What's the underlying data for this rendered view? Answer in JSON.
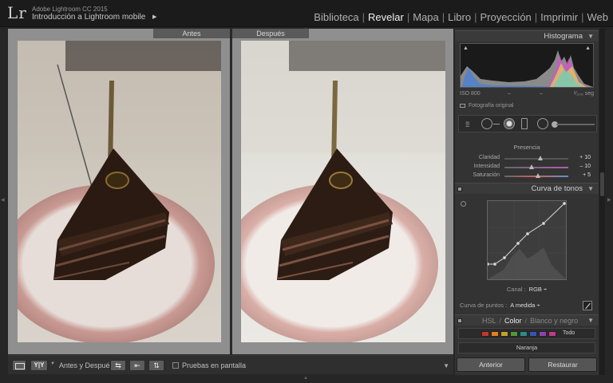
{
  "app": {
    "logo": "Lr",
    "name": "Adobe Lightroom CC 2015",
    "catalog": "Introducción a Lightroom mobile",
    "catalog_arrow": "▶"
  },
  "modules": [
    {
      "label": "Biblioteca",
      "active": false
    },
    {
      "label": "Revelar",
      "active": true
    },
    {
      "label": "Mapa",
      "active": false
    },
    {
      "label": "Libro",
      "active": false
    },
    {
      "label": "Proyección",
      "active": false
    },
    {
      "label": "Imprimir",
      "active": false
    },
    {
      "label": "Web",
      "active": false
    }
  ],
  "view": {
    "before_label": "Antes",
    "after_label": "Después"
  },
  "toolbar": {
    "yy_label": "Y|Y",
    "compare_label": "Antes y Después:",
    "swap1_glyph": "⇆",
    "swap2_glyph": "⇤",
    "swap3_glyph": "⇅",
    "proof_label": "Pruebas en pantalla",
    "menu_arrow": "▼"
  },
  "histogram": {
    "title": "Histograma",
    "iso": "ISO 800",
    "dash1": "–",
    "dash2": "–",
    "shutter": "¹⁄₂₀₀ seg",
    "original_label": "Fotografía original",
    "clip_glyph": "▲"
  },
  "presence": {
    "title": "Presencia",
    "rows": [
      {
        "label": "Claridad",
        "value": "+ 10"
      },
      {
        "label": "Intensidad",
        "value": "– 10"
      },
      {
        "label": "Saturación",
        "value": "+ 5"
      }
    ]
  },
  "tone_curve": {
    "title": "Curva de tonos",
    "channel_label": "Canal :",
    "channel_value": "RGB ÷",
    "points_label": "Curva de puntos :",
    "points_value": "A medida ÷"
  },
  "hsl": {
    "hsl_label": "HSL",
    "color_label": "Color",
    "bw_label": "Blanco y negro",
    "all_label": "Todo",
    "selected_color": "Naranja",
    "swatches": [
      "#c0392b",
      "#e67e22",
      "#c9a227",
      "#4f9a3a",
      "#2e8b8b",
      "#3456b4",
      "#8e44ad",
      "#c23a8a"
    ]
  },
  "buttons": {
    "previous": "Anterior",
    "reset": "Restaurar"
  },
  "panel_arrow": "▼"
}
